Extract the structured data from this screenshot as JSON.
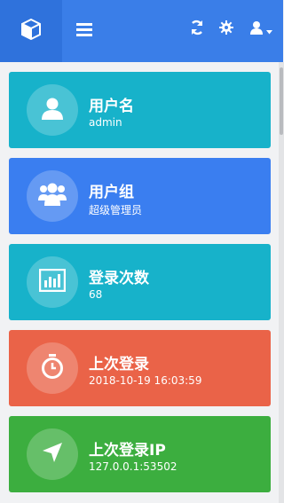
{
  "colors": {
    "topbar": "#3a7ee8",
    "brand_block": "#2f72dc",
    "teal": "#17b2ca",
    "blue": "#3a7ef0",
    "orange": "#ea6348",
    "green": "#3cae3f"
  },
  "header": {
    "brand_icon": "cube-icon",
    "menu_icon": "hamburger-menu-icon",
    "refresh_icon": "refresh-icon",
    "settings_icon": "gear-icon",
    "user_icon": "user-icon"
  },
  "cards": [
    {
      "title": "用户名",
      "value": "admin",
      "icon": "user-icon",
      "color": "#17b2ca"
    },
    {
      "title": "用户组",
      "value": "超级管理员",
      "icon": "user-group-icon",
      "color": "#3a7ef0"
    },
    {
      "title": "登录次数",
      "value": "68",
      "icon": "bar-chart-icon",
      "color": "#17b2ca"
    },
    {
      "title": "上次登录",
      "value": "2018-10-19 16:03:59",
      "icon": "clock-icon",
      "color": "#ea6348"
    },
    {
      "title": "上次登录IP",
      "value": "127.0.0.1:53502",
      "icon": "location-arrow-icon",
      "color": "#3cae3f"
    }
  ]
}
